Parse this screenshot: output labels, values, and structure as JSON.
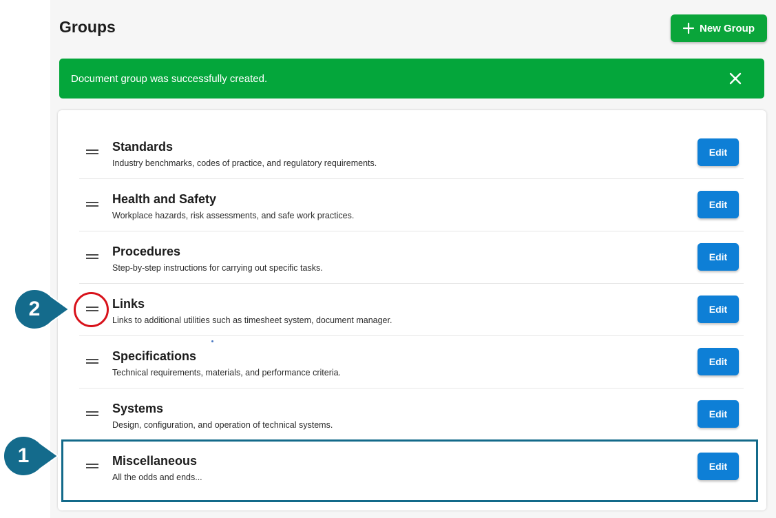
{
  "header": {
    "title": "Groups",
    "new_group_label": "New Group"
  },
  "alert": {
    "message": "Document group was successfully created."
  },
  "groups": [
    {
      "name": "Standards",
      "description": "Industry benchmarks, codes of practice, and regulatory requirements.",
      "edit_label": "Edit"
    },
    {
      "name": "Health and Safety",
      "description": "Workplace hazards, risk assessments, and safe work practices.",
      "edit_label": "Edit"
    },
    {
      "name": "Procedures",
      "description": "Step-by-step instructions for carrying out specific tasks.",
      "edit_label": "Edit"
    },
    {
      "name": "Links",
      "description": "Links to additional utilities such as timesheet system, document manager.",
      "edit_label": "Edit"
    },
    {
      "name": "Specifications",
      "description": "Technical requirements, materials, and performance criteria.",
      "edit_label": "Edit"
    },
    {
      "name": "Systems",
      "description": "Design, configuration, and operation of technical systems.",
      "edit_label": "Edit"
    },
    {
      "name": "Miscellaneous",
      "description": "All the odds and ends...",
      "edit_label": "Edit"
    }
  ],
  "annotations": {
    "callout_1": "1",
    "callout_2": "2"
  },
  "colors": {
    "success_green": "#04a63b",
    "button_green": "#0aa53a",
    "edit_blue": "#0e7fd6",
    "callout_blue": "#146b8c",
    "highlight_red": "#d8121b"
  },
  "icons": {
    "new_group": "plus-icon",
    "alert_close": "close-icon",
    "row_handle": "drag-handle-icon"
  }
}
